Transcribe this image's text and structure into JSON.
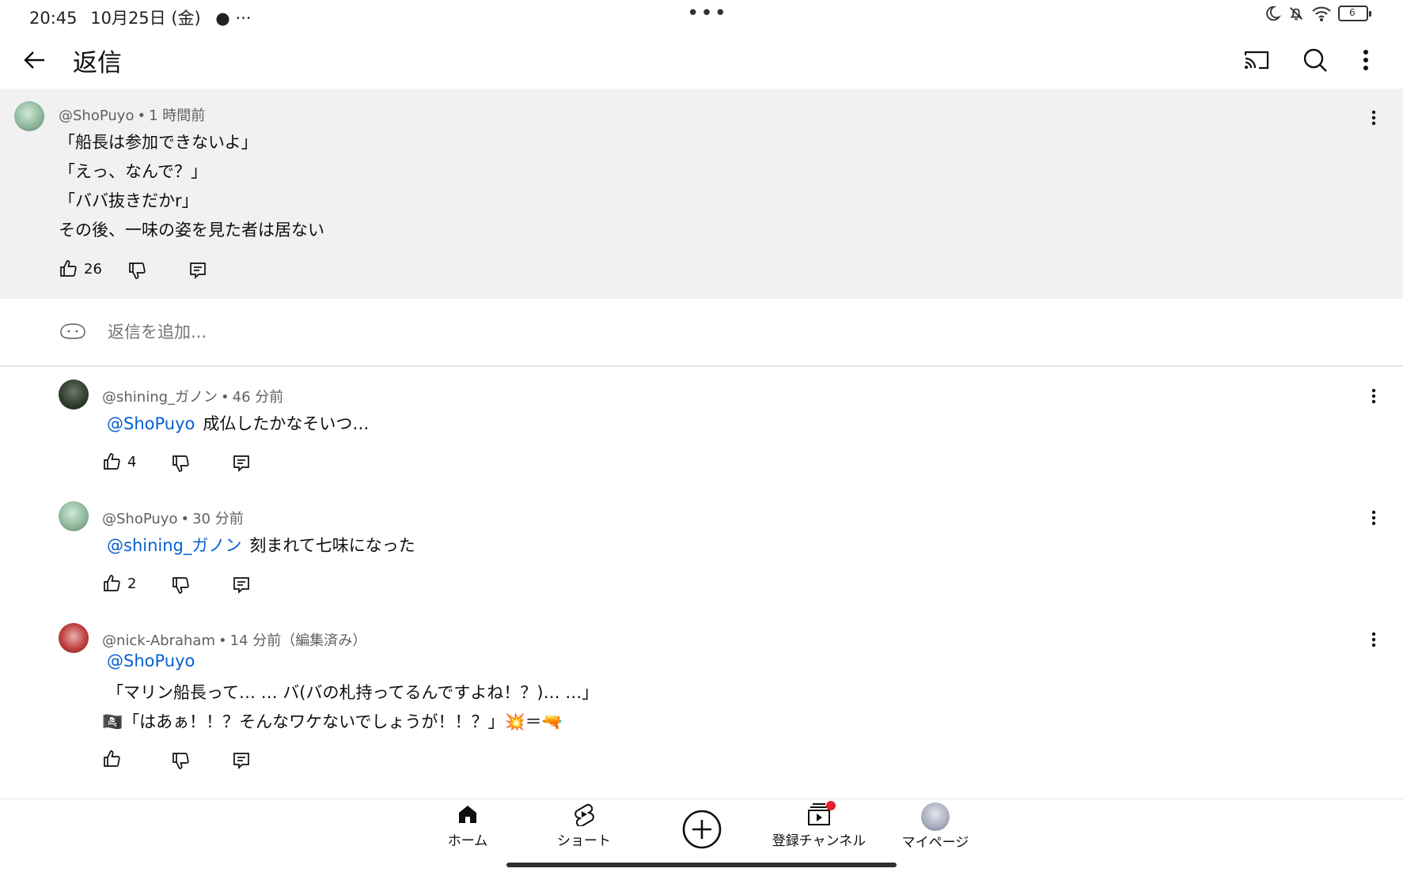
{
  "status_bar": {
    "time": "20:45",
    "date": "10月25日 (金)",
    "extra": "···",
    "center_dots": "•••",
    "battery": "6",
    "icons": [
      "moon-icon",
      "bell-off-icon",
      "wifi-icon",
      "battery-icon"
    ]
  },
  "app_bar": {
    "title": "返信",
    "icons": [
      "back-arrow-icon",
      "cast-icon",
      "search-icon",
      "more-vert-icon"
    ]
  },
  "top_comment": {
    "author": "@ShoPuyo",
    "time": "1 時間前",
    "lines": [
      "「船長は参加できないよ」",
      "「えっ、なんで？」",
      "「ババ抜きだかr」",
      "その後、一味の姿を見た者は居ない"
    ],
    "likes": "26"
  },
  "add_reply": {
    "placeholder": "返信を追加..."
  },
  "replies": [
    {
      "author": "@shining_ガノン",
      "time": "46 分前",
      "mention": "@ShoPuyo",
      "text": "成仏したかなそいつ…",
      "likes": "4"
    },
    {
      "author": "@ShoPuyo",
      "time": "30 分前",
      "mention": "@shining_ガノン",
      "text": "刻まれて七味になった",
      "likes": "2"
    },
    {
      "author": "@nick-Abraham",
      "time": "14 分前（編集済み）",
      "mention": "@ShoPuyo",
      "line1": "「マリン船長って… … バ(バの札持ってるんですよね！？)… …」",
      "line2": "🏴‍☠️「はあぁ！！？そんなワケないでしょうが！！？」💥＝🔫",
      "likes": ""
    }
  ],
  "bottom_nav": {
    "items": [
      {
        "label": "ホーム",
        "icon": "home-icon"
      },
      {
        "label": "ショート",
        "icon": "shorts-icon"
      },
      {
        "label": "",
        "icon": "create-plus-icon"
      },
      {
        "label": "登録チャンネル",
        "icon": "subscriptions-icon"
      },
      {
        "label": "マイページ",
        "icon": "avatar"
      }
    ]
  },
  "colors": {
    "mention": "#065fd4",
    "highlight_bg": "#f1f1f1",
    "notification_dot": "#e5202b"
  }
}
